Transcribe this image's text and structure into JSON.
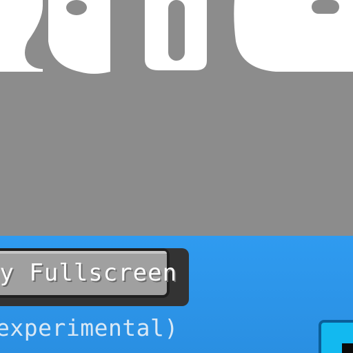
{
  "screen": {
    "background_color": "#8c8c8c",
    "panel_color": "#2f9bf0"
  },
  "logo": {
    "color": "#ffffff"
  },
  "fullscreen_button": {
    "label": "ry Fullscreen"
  },
  "experimental_note": {
    "text": "experimental)"
  },
  "corner_widget": {
    "color": "#12b9f0"
  }
}
